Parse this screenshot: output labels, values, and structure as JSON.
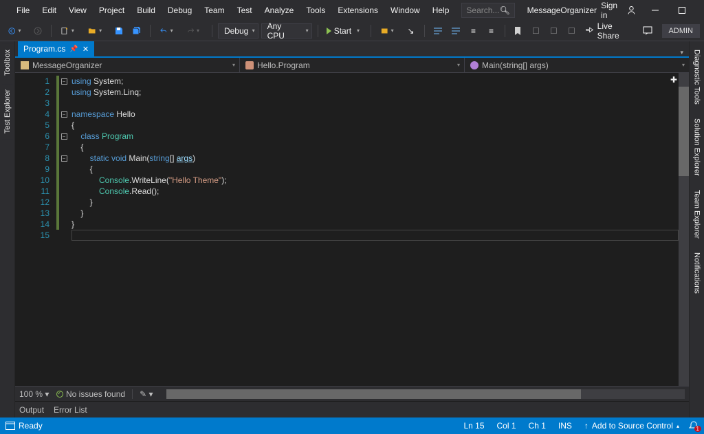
{
  "menu": [
    "File",
    "Edit",
    "View",
    "Project",
    "Build",
    "Debug",
    "Team",
    "Test",
    "Analyze",
    "Tools",
    "Extensions",
    "Window",
    "Help"
  ],
  "search_placeholder": "Search...",
  "project_name": "MessageOrganizer",
  "titlebar": {
    "signin": "Sign in"
  },
  "toolbar": {
    "config": "Debug",
    "platform": "Any CPU",
    "start": "Start",
    "liveshare": "Live Share",
    "admin": "ADMIN"
  },
  "side_left": [
    "Toolbox",
    "Test Explorer"
  ],
  "side_right": [
    "Diagnostic Tools",
    "Solution Explorer",
    "Team Explorer",
    "Notifications"
  ],
  "doc_tab": {
    "name": "Program.cs"
  },
  "nav": {
    "scope": "MessageOrganizer",
    "class": "Hello.Program",
    "member": "Main(string[] args)"
  },
  "code": {
    "lines": 15,
    "l1a": "using",
    "l1b": " System;",
    "l2a": "using",
    "l2b": " System.Linq;",
    "l4a": "namespace",
    "l4b": " Hello",
    "l5": "{",
    "l6a": "    class",
    "l6b": " Program",
    "l7": "    {",
    "l8a": "        static",
    "l8b": " void",
    "l8c": " Main(",
    "l8d": "string",
    "l8e": "[] ",
    "l8f": "args",
    "l8g": ")",
    "l9": "        {",
    "l10a": "            Console",
    "l10b": ".WriteLine(",
    "l10c": "\"Hello Theme\"",
    "l10d": ");",
    "l11a": "            Console",
    "l11b": ".Read();",
    "l12": "        }",
    "l13": "    }",
    "l14": "}"
  },
  "code_footer": {
    "zoom": "100 %",
    "issues": "No issues found"
  },
  "bottom_tabs": [
    "Output",
    "Error List"
  ],
  "status": {
    "ready": "Ready",
    "line": "Ln 15",
    "col": "Col 1",
    "ch": "Ch 1",
    "ins": "INS",
    "source_control": "Add to Source Control",
    "notifications": "1"
  }
}
